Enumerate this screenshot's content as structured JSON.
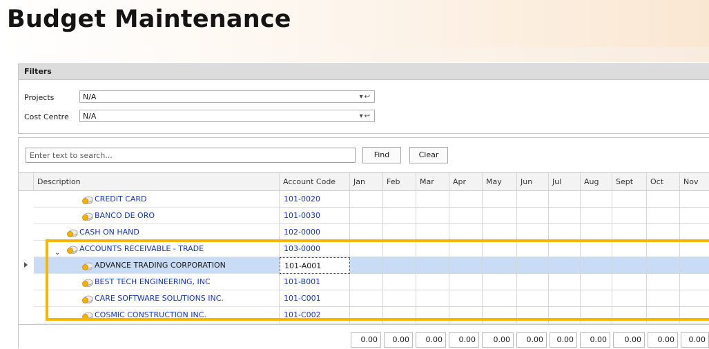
{
  "page": {
    "title": "Budget Maintenance"
  },
  "filters": {
    "heading": "Filters",
    "projects": {
      "label": "Projects",
      "value": "N/A"
    },
    "cost_centre": {
      "label": "Cost Centre",
      "value": "N/A"
    }
  },
  "search": {
    "placeholder": "Enter text to search...",
    "find_label": "Find",
    "clear_label": "Clear"
  },
  "grid": {
    "columns": [
      "Description",
      "Account Code",
      "Jan",
      "Feb",
      "Mar",
      "Apr",
      "May",
      "Jun",
      "Jul",
      "Aug",
      "Sept",
      "Oct",
      "Nov"
    ],
    "rows": [
      {
        "description": "CREDIT CARD",
        "code": "101-0020",
        "level": 2
      },
      {
        "description": "BANCO DE ORO",
        "code": "101-0030",
        "level": 2
      },
      {
        "description": "CASH ON HAND",
        "code": "102-0000",
        "level": 1
      },
      {
        "description": "ACCOUNTS RECEIVABLE - TRADE",
        "code": "103-0000",
        "level": 1,
        "expanded": true
      },
      {
        "description": "ADVANCE TRADING CORPORATION",
        "code": "101-A001",
        "level": 2,
        "selected": true
      },
      {
        "description": "BEST TECH ENGINEERING, INC",
        "code": "101-B001",
        "level": 2
      },
      {
        "description": "CARE SOFTWARE SOLUTIONS INC.",
        "code": "101-C001",
        "level": 2
      },
      {
        "description": "COSMIC CONSTRUCTION INC.",
        "code": "101-C002",
        "level": 2
      }
    ],
    "totals": [
      "0.00",
      "0.00",
      "0.00",
      "0.00",
      "0.00",
      "0.00",
      "0.00",
      "0.00",
      "0.00",
      "0.00",
      "0.00"
    ]
  },
  "colors": {
    "accent_highlight": "#f7b500",
    "link_text": "#1133cc",
    "selected_row": "#c9dcf5"
  }
}
